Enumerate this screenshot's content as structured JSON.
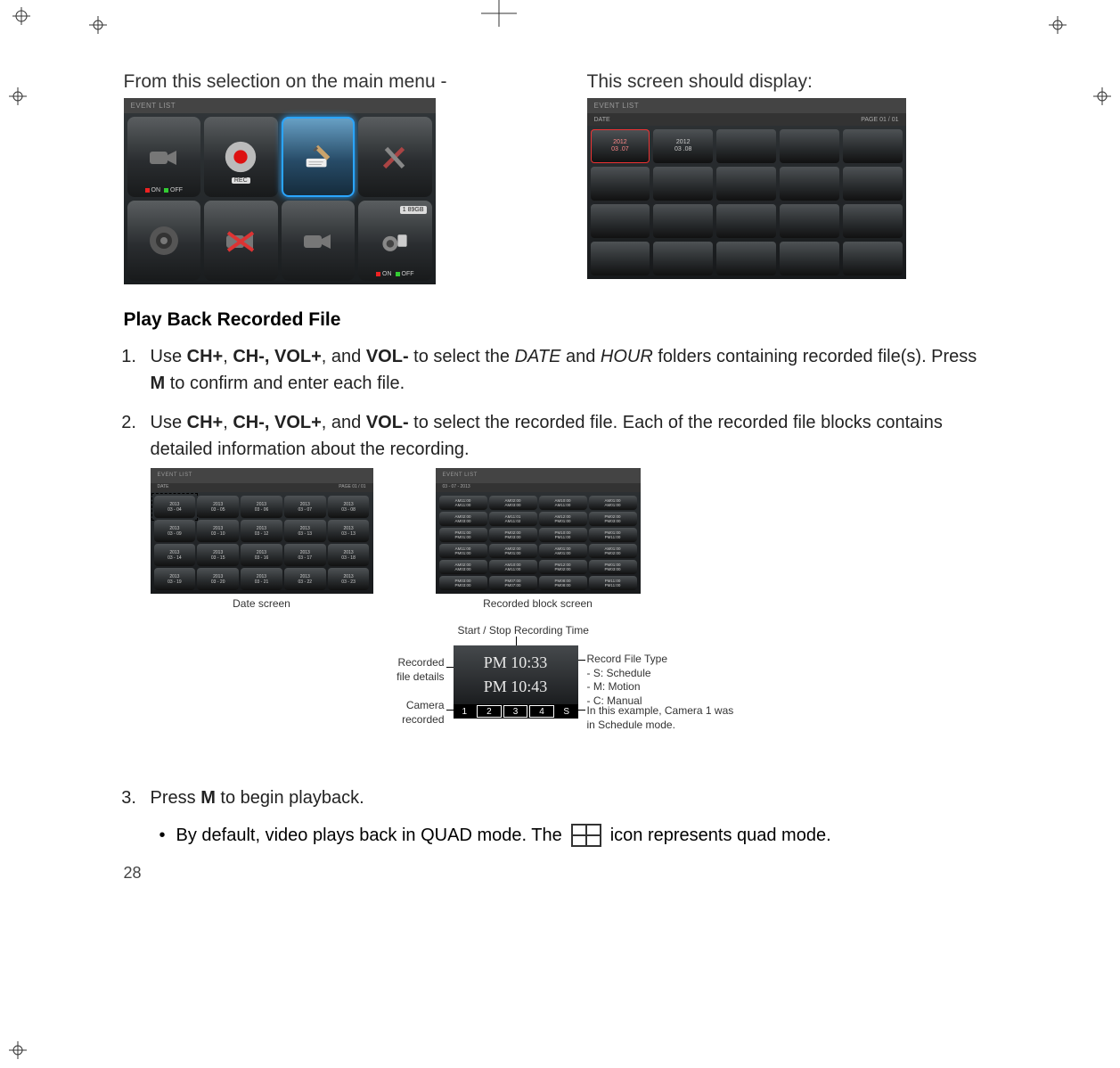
{
  "captions": {
    "left": "From this selection on the main menu -",
    "right": "This screen should display:"
  },
  "menu_screen": {
    "title": "EVENT LIST",
    "tiles": [
      {
        "name": "camera-tile",
        "on": "ON",
        "off": "OFF",
        "selected": false
      },
      {
        "name": "rec-tile",
        "label": "REC",
        "selected": false
      },
      {
        "name": "write-tile",
        "selected": true
      },
      {
        "name": "tools-tile",
        "selected": false
      },
      {
        "name": "speaker-tile",
        "selected": false
      },
      {
        "name": "disabled-cam-tile",
        "selected": false
      },
      {
        "name": "cam2-tile",
        "selected": false
      },
      {
        "name": "storage-tile",
        "badge": "1  89GB",
        "on": "ON",
        "off": "OFF",
        "selected": false
      }
    ]
  },
  "date_screen": {
    "title": "EVENT LIST",
    "subtitle": "DATE",
    "page": "PAGE 01 / 01",
    "tiles": [
      {
        "y": "2012",
        "d": "03 .07",
        "sel": true
      },
      {
        "y": "2012",
        "d": "03 .08"
      },
      {},
      {},
      {},
      {},
      {},
      {},
      {},
      {},
      {},
      {},
      {},
      {},
      {},
      {},
      {},
      {},
      {},
      {}
    ]
  },
  "section_title": "Play Back Recorded File",
  "step1": {
    "pre": "Use ",
    "b1": "CH+",
    "c1": ", ",
    "b2": "CH-, VOL+",
    "c2": ", and ",
    "b3": "VOL-",
    "c3": " to select the ",
    "i1": "DATE",
    "c4": " and ",
    "i2": "HOUR",
    "c5": " folders containing recorded file(s). Press ",
    "b4": "M",
    "c6": " to confirm and enter each file."
  },
  "step2": {
    "pre": "Use ",
    "b1": "CH+",
    "c1": ", ",
    "b2": "CH-, VOL+",
    "c2": ", and ",
    "b3": "VOL-",
    "c3": " to select the recorded file. Each of the recorded file blocks contains detailed information about the recording."
  },
  "mini": {
    "date": {
      "title": "EVENT LIST",
      "sub": "DATE",
      "page": "PAGE 01 / 01",
      "label": "Date screen",
      "cells": [
        [
          "2013",
          "03 - 04"
        ],
        [
          "2013",
          "03 - 05"
        ],
        [
          "2013",
          "03 - 06"
        ],
        [
          "2013",
          "03 - 07"
        ],
        [
          "2013",
          "03 - 08"
        ],
        [
          "2013",
          "03 - 09"
        ],
        [
          "2013",
          "03 - 10"
        ],
        [
          "2013",
          "03 - 12"
        ],
        [
          "2013",
          "03 - 13"
        ],
        [
          "2013",
          "03 - 13"
        ],
        [
          "2013",
          "03 - 14"
        ],
        [
          "2013",
          "03 - 15"
        ],
        [
          "2013",
          "03 - 16"
        ],
        [
          "2013",
          "03 - 17"
        ],
        [
          "2013",
          "03 - 18"
        ],
        [
          "2013",
          "03 - 19"
        ],
        [
          "2013",
          "03 - 20"
        ],
        [
          "2013",
          "03 - 21"
        ],
        [
          "2013",
          "03 - 22"
        ],
        [
          "2013",
          "03 - 23"
        ]
      ]
    },
    "hour": {
      "title": "EVENT LIST",
      "sub": "03 - 07 - 2013",
      "label": "Recorded block screen",
      "cells": [
        [
          "AM11:00",
          "AM11:00"
        ],
        [
          "AM02:00",
          "AM03:00"
        ],
        [
          "AM10:00",
          "AM11:00"
        ],
        [
          "AM01:00",
          "AM01:00"
        ],
        [
          "AM02:00",
          "AM03:00"
        ],
        [
          "AM11:01",
          "AM11:02"
        ],
        [
          "AM12:00",
          "PM01:00"
        ],
        [
          "PM02:00",
          "PM03:00"
        ],
        [
          "PM01:00",
          "PM01:00"
        ],
        [
          "PM02:00",
          "PM03:00"
        ],
        [
          "PM10:00",
          "PM11:00"
        ],
        [
          "PM01:00",
          "PM11:00"
        ],
        [
          "AM11:00",
          "PM01:00"
        ],
        [
          "AM02:00",
          "PM01:00"
        ],
        [
          "AM01:00",
          "AM01:00"
        ],
        [
          "AM01:00",
          "PM02:00"
        ],
        [
          "AM02:00",
          "AM03:00"
        ],
        [
          "AM10:00",
          "AM11:00"
        ],
        [
          "PM12:00",
          "PM02:00"
        ],
        [
          "PM01:00",
          "PM03:00"
        ],
        [
          "PM03:00",
          "PM03:00"
        ],
        [
          "PM07:00",
          "PM07:00"
        ],
        [
          "PM08:00",
          "PM08:00"
        ],
        [
          "PM11:00",
          "PM11:00"
        ]
      ]
    }
  },
  "detail": {
    "top_ann": "Start / Stop Recording Time",
    "left_ann1": "Recorded",
    "left_ann1b": "file details",
    "left_ann2": "Camera",
    "left_ann2b": "recorded",
    "time1": "PM 10:33",
    "time2": "PM 10:43",
    "cams": [
      "1",
      "2",
      "3",
      "4",
      "S"
    ],
    "right_ann_title": "Record File Type",
    "right_ann_l1": "- S: Schedule",
    "right_ann_l2": "- M: Motion",
    "right_ann_l3": "- C: Manual",
    "right_ann_note1": "In this example, Camera 1 was",
    "right_ann_note2": "in Schedule mode."
  },
  "step3": {
    "pre": "Press ",
    "b1": "M",
    "post": " to begin playback."
  },
  "bullet": {
    "pre": "By default, video plays back in QUAD mode. The ",
    "post": " icon represents quad mode."
  },
  "page_number": "28"
}
